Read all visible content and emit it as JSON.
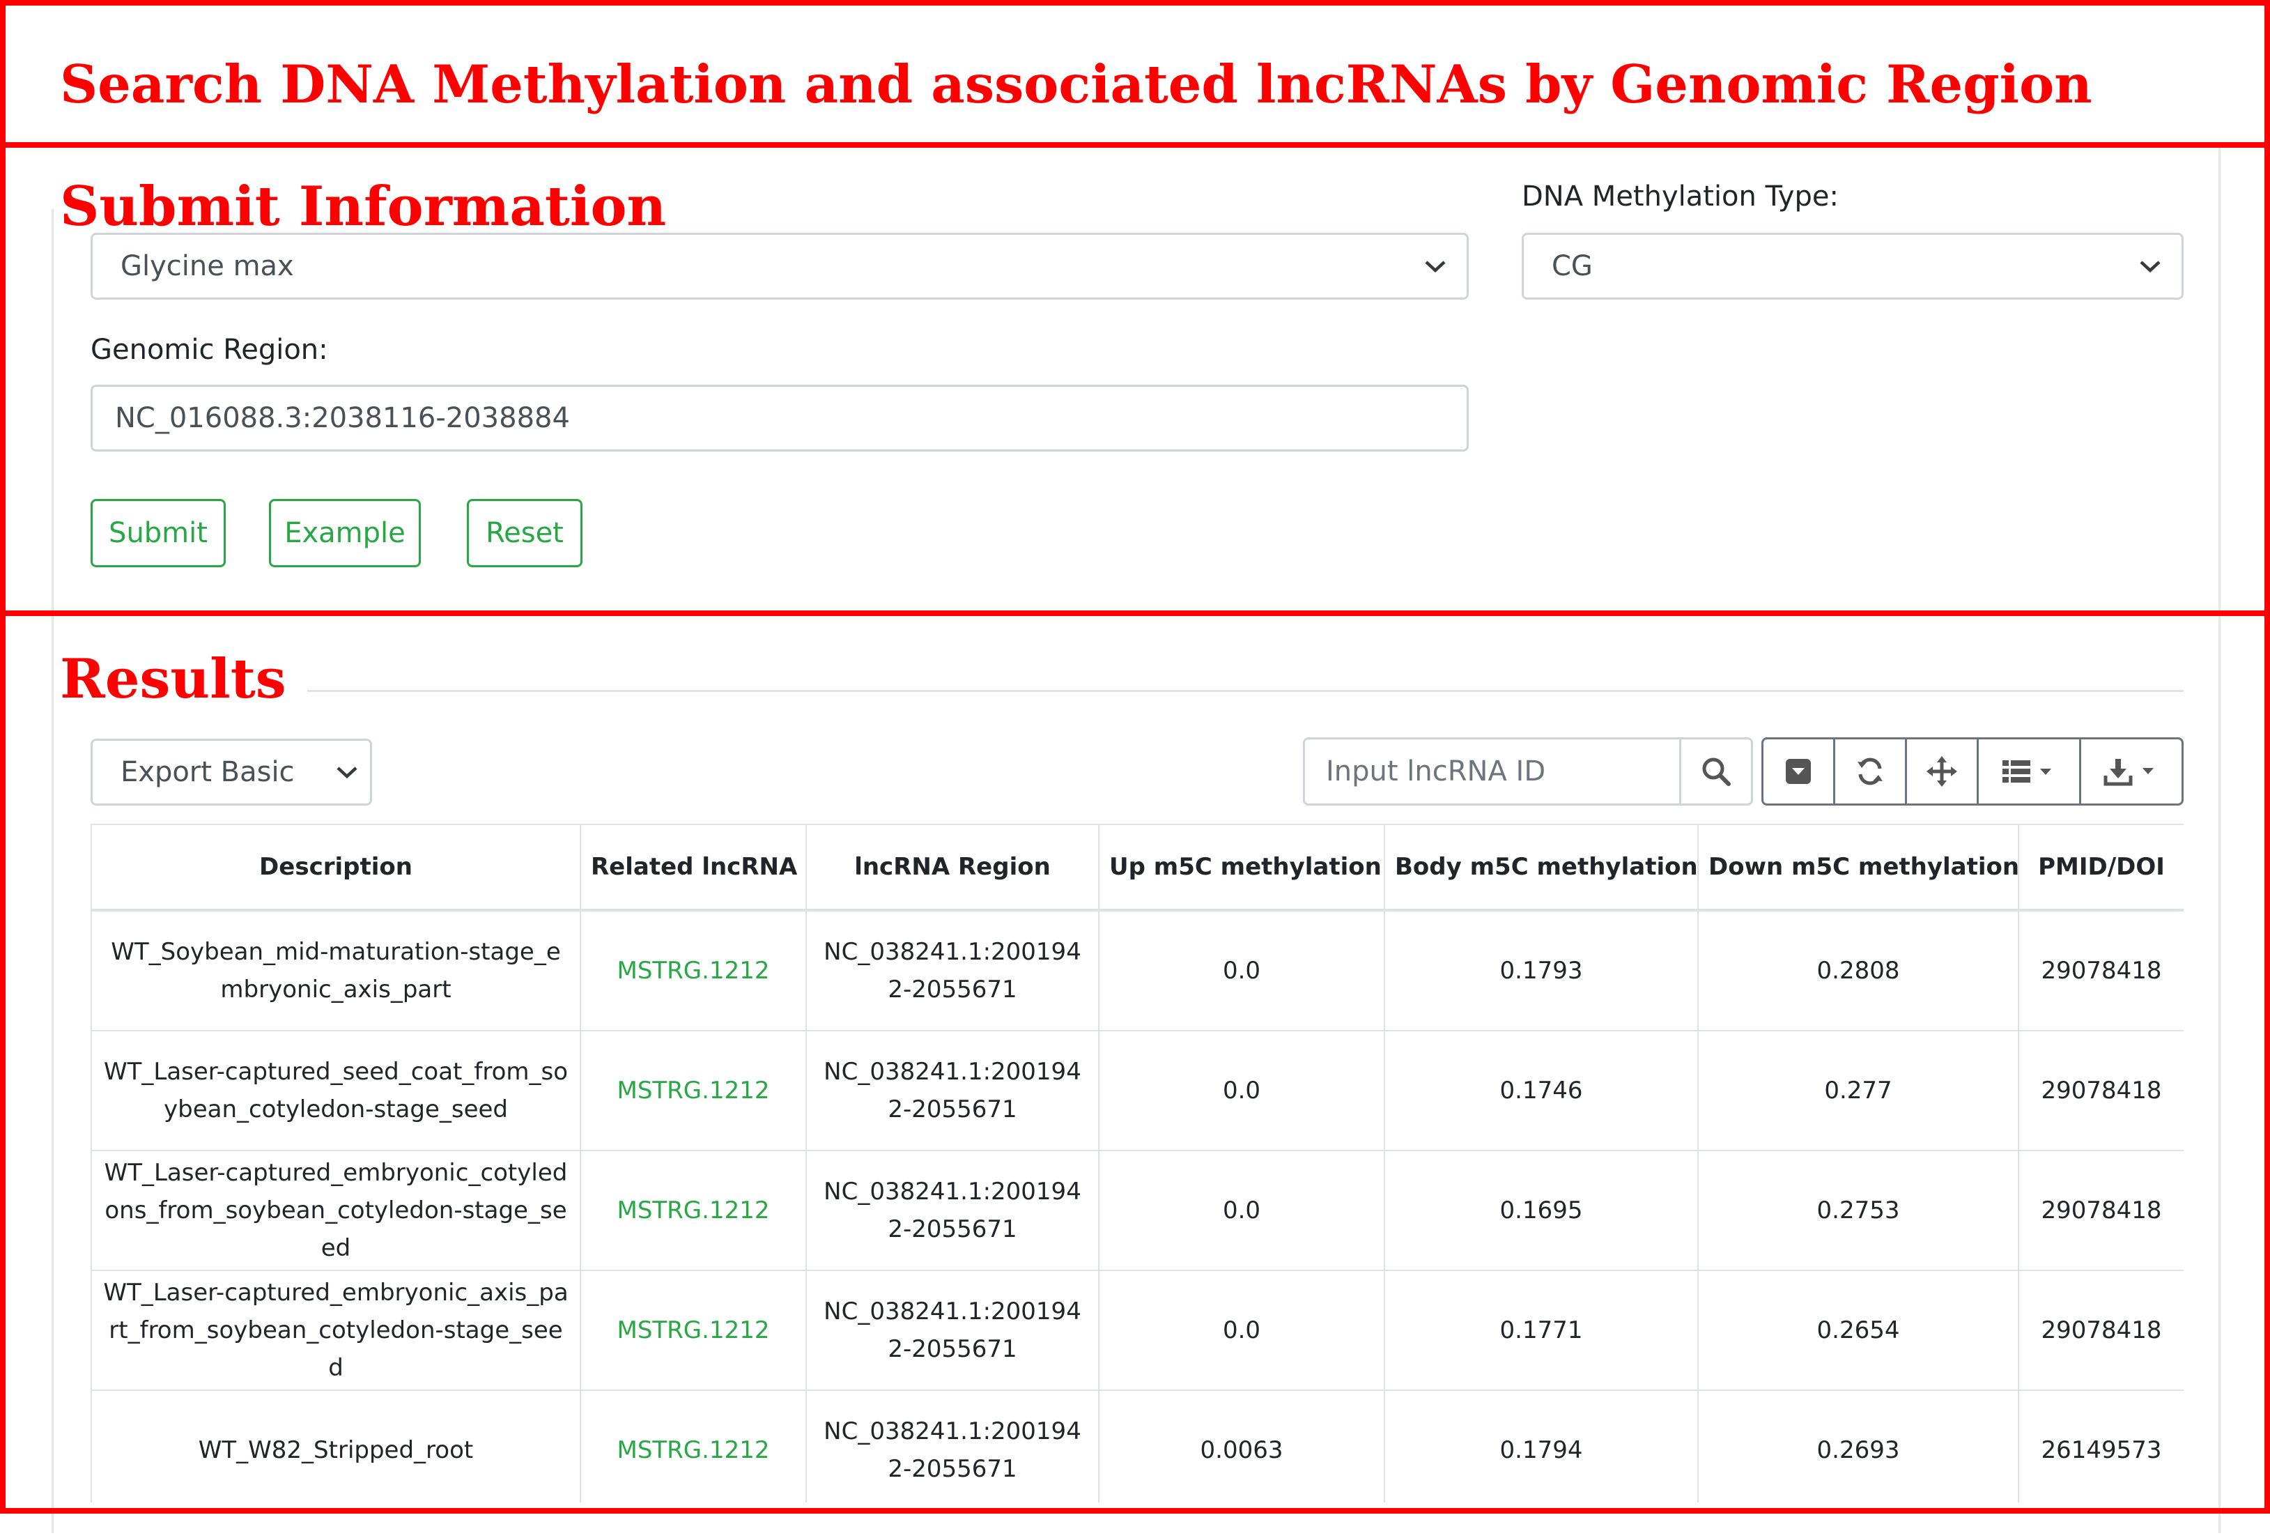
{
  "annotations": {
    "page_title": "Search DNA Methylation and associated lncRNAs by Genomic Region",
    "submit_section": "Submit Information",
    "results_section": "Results"
  },
  "form": {
    "species_value": "Glycine max",
    "methylation_type_label": "DNA Methylation Type:",
    "methylation_type_value": "CG",
    "genomic_region_label": "Genomic Region:",
    "genomic_region_value": "NC_016088.3:2038116-2038884",
    "buttons": {
      "submit": "Submit",
      "example": "Example",
      "reset": "Reset"
    }
  },
  "toolbar": {
    "export_value": "Export Basic",
    "search_placeholder": "Input lncRNA ID",
    "icons": [
      "search-icon",
      "toggle-icon",
      "refresh-icon",
      "move-icon",
      "columns-icon",
      "download-icon"
    ]
  },
  "table": {
    "headers": [
      "Description",
      "Related lncRNA",
      "lncRNA Region",
      "Up m5C methylation",
      "Body m5C methylation",
      "Down m5C methylation",
      "PMID/DOI"
    ],
    "rows": [
      [
        "WT_Soybean_mid-maturation-stage_embryonic_axis_part",
        "MSTRG.1212",
        "NC_038241.1:2001942-2055671",
        "0.0",
        "0.1793",
        "0.2808",
        "29078418"
      ],
      [
        "WT_Laser-captured_seed_coat_from_soybean_cotyledon-stage_seed",
        "MSTRG.1212",
        "NC_038241.1:2001942-2055671",
        "0.0",
        "0.1746",
        "0.277",
        "29078418"
      ],
      [
        "WT_Laser-captured_embryonic_cotyledons_from_soybean_cotyledon-stage_seed",
        "MSTRG.1212",
        "NC_038241.1:2001942-2055671",
        "0.0",
        "0.1695",
        "0.2753",
        "29078418"
      ],
      [
        "WT_Laser-captured_embryonic_axis_part_from_soybean_cotyledon-stage_seed",
        "MSTRG.1212",
        "NC_038241.1:2001942-2055671",
        "0.0",
        "0.1771",
        "0.2654",
        "29078418"
      ],
      [
        "WT_W82_Stripped_root",
        "MSTRG.1212",
        "NC_038241.1:2001942-2055671",
        "0.0063",
        "0.1794",
        "0.2693",
        "26149573"
      ]
    ]
  },
  "colors": {
    "annotation": "#ff0000",
    "accent": "#28a745",
    "border": "#dee2e6"
  }
}
